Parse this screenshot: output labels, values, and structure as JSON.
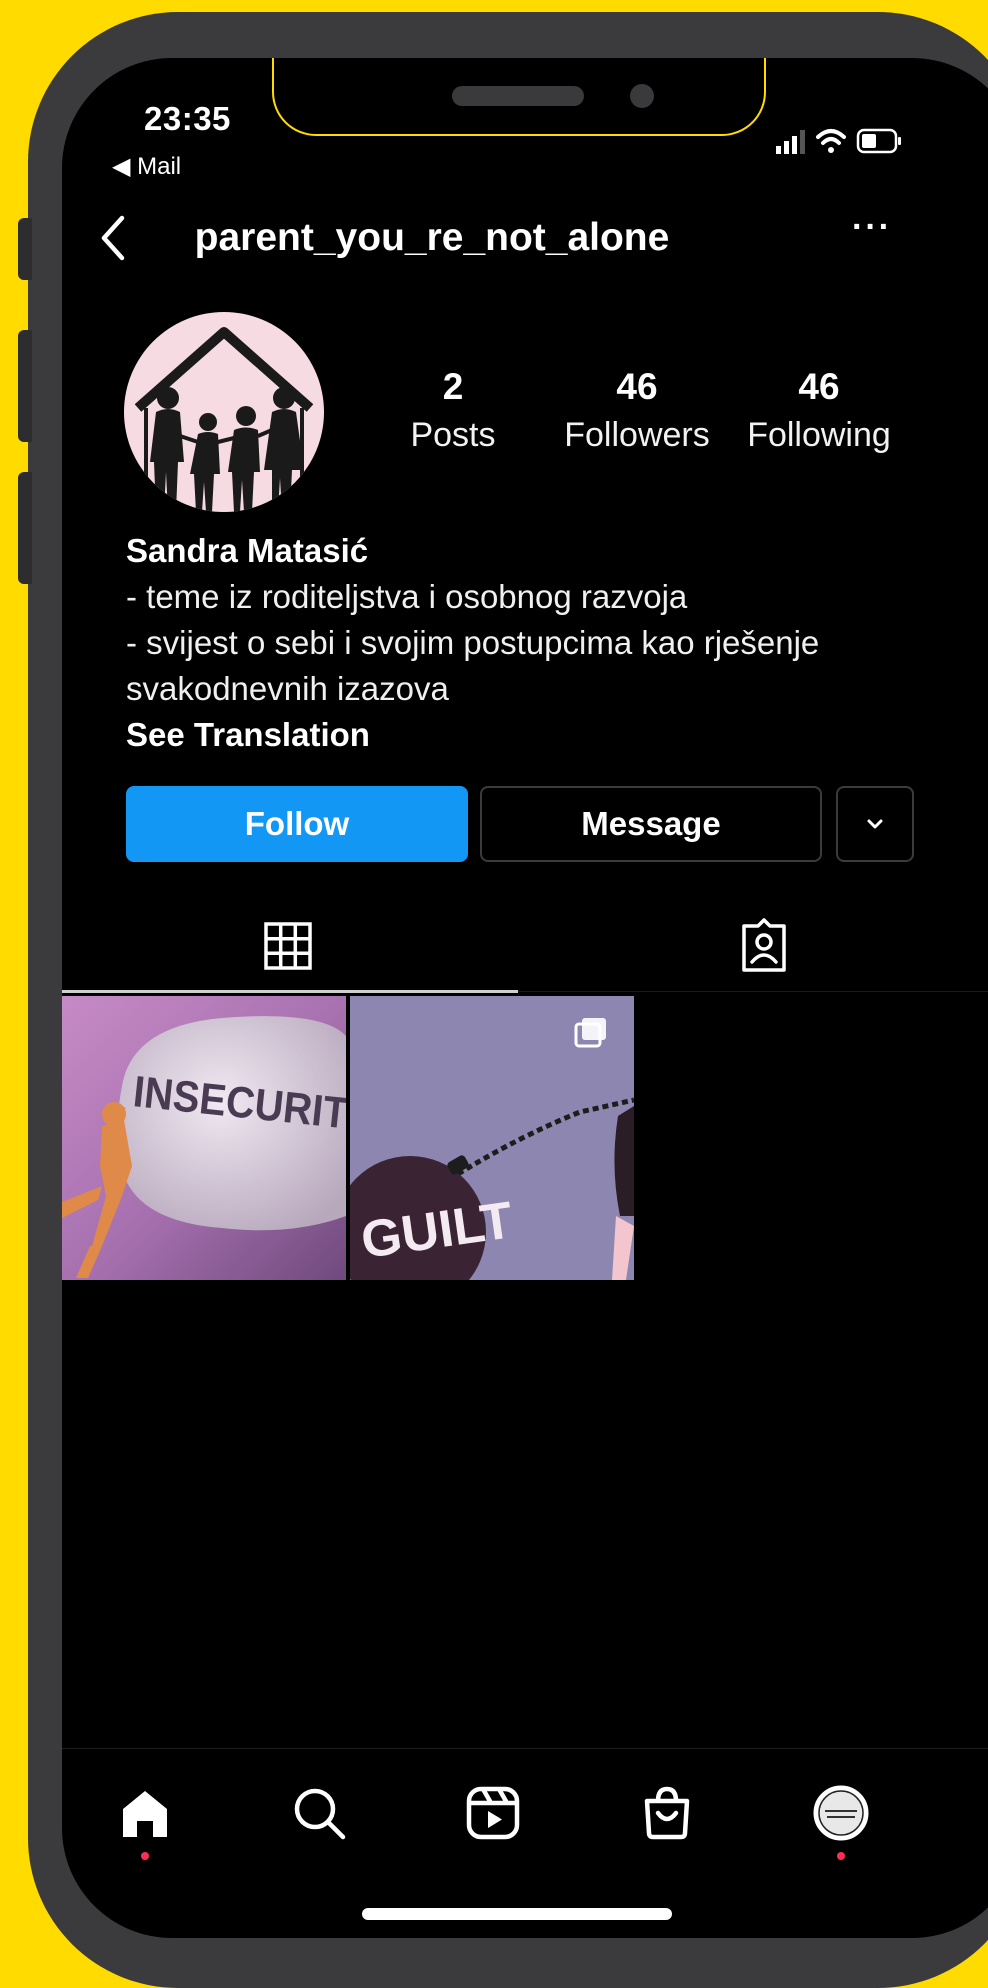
{
  "status_bar": {
    "time": "23:35",
    "back_app": "◀ Mail"
  },
  "header": {
    "username": "parent_you_re_not_alone",
    "more_label": "···"
  },
  "profile": {
    "stats": [
      {
        "value": "2",
        "label": "Posts"
      },
      {
        "value": "46",
        "label": "Followers"
      },
      {
        "value": "46",
        "label": "Following"
      }
    ],
    "name": "Sandra Matasić",
    "bio_lines": [
      "- teme iz roditeljstva i osobnog razvoja",
      "- svijest o sebi i svojim postupcima kao rješenje",
      "svakodnevnih izazova"
    ],
    "see_translation": "See Translation"
  },
  "actions": {
    "follow": "Follow",
    "message": "Message"
  },
  "posts": [
    {
      "text": "INSECURIT",
      "colors": {
        "bg": "#b37fbc",
        "rock": "#ddd3e0"
      }
    },
    {
      "text": "GUILT",
      "colors": {
        "bg": "#8d86b1",
        "ball": "#3a2434"
      }
    }
  ],
  "colors": {
    "background": "#FFDB00",
    "accent": "#1297F5",
    "notification": "#FF2D55"
  },
  "icons": {
    "tabs": [
      "grid-icon",
      "tagged-icon"
    ],
    "bottom_nav": [
      "home-icon",
      "search-icon",
      "reels-icon",
      "shop-icon",
      "profile-icon"
    ]
  }
}
